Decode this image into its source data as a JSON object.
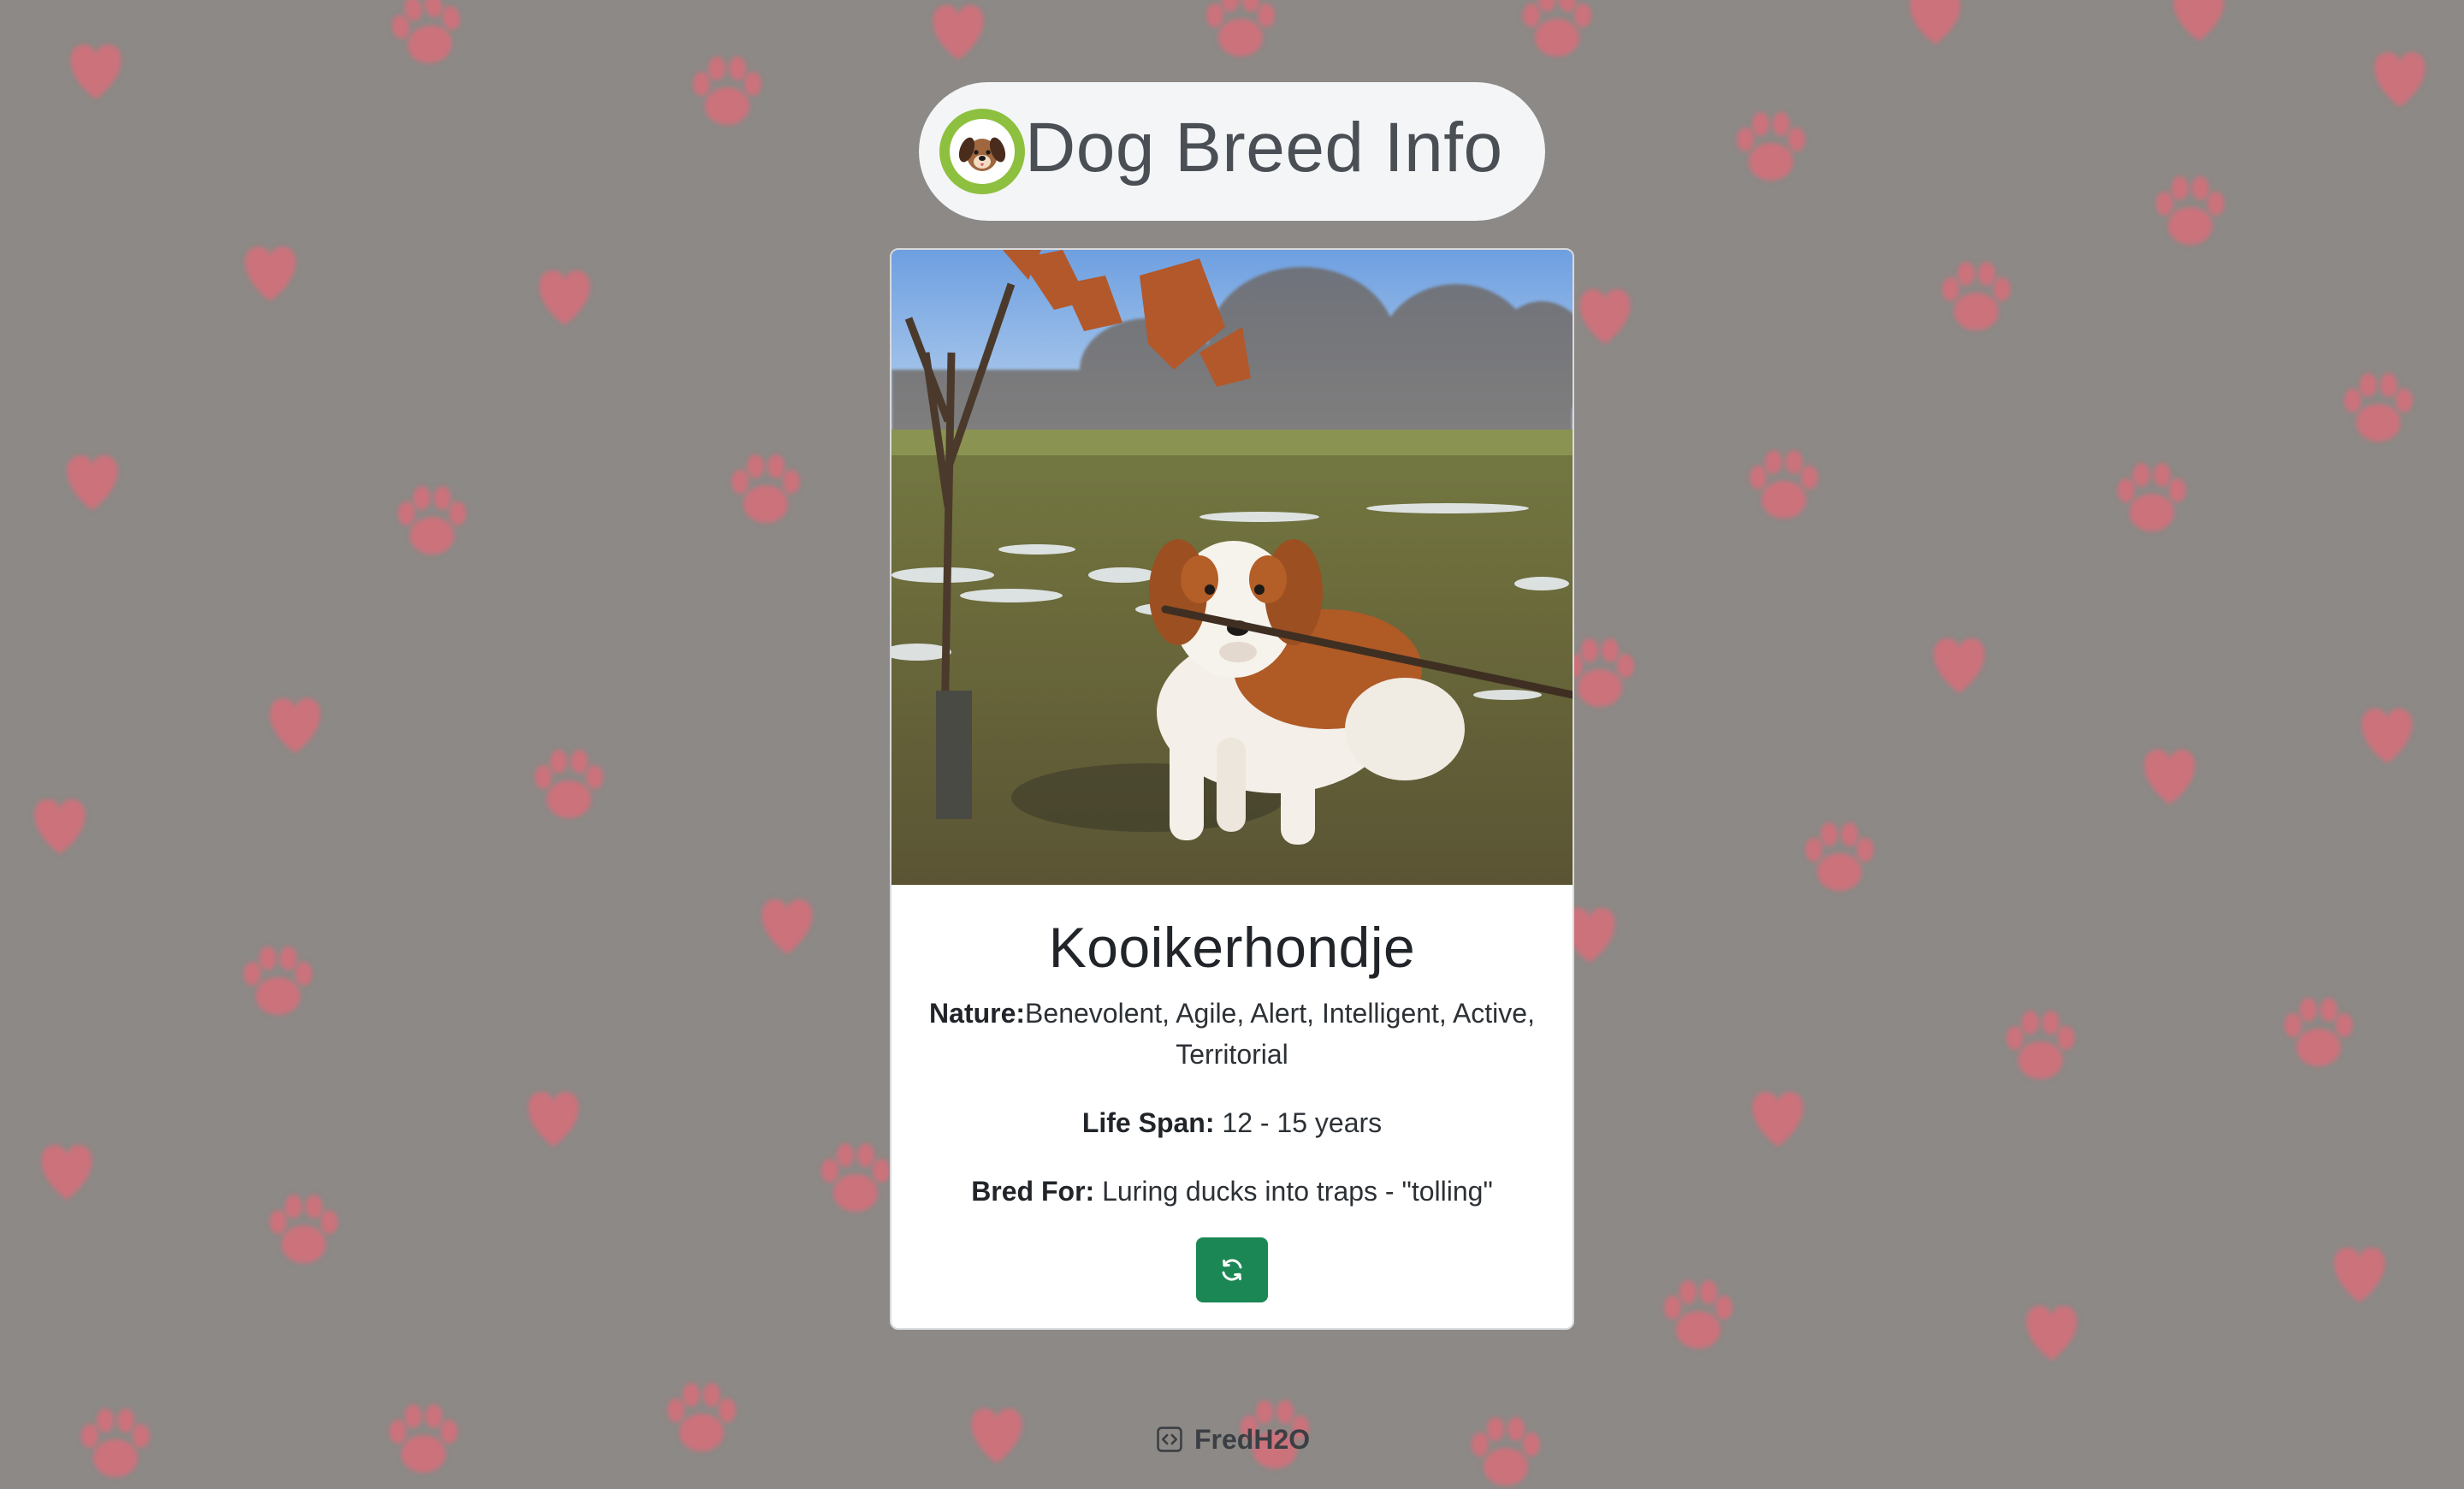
{
  "app": {
    "title": "Dog Breed Info"
  },
  "breed": {
    "name": "Kooikerhondje",
    "nature_label": "Nature:",
    "nature_value": "Benevolent, Agile, Alert, Intelligent, Active, Territorial",
    "lifespan_label": "Life Span:",
    "lifespan_value": "12 - 15 years",
    "bredfor_label": "Bred For:",
    "bredfor_value": "Luring ducks into traps - \"tolling\""
  },
  "icons": {
    "logo": "dog-face-icon",
    "refresh": "refresh-icon",
    "footer": "code-icon",
    "background": "paw-print-icon"
  },
  "footer": {
    "author": "FredH2O"
  },
  "colors": {
    "background": "#8c8986",
    "paw": "#d4707a",
    "button": "#1a8754",
    "logo_ring": "#8ec03f"
  }
}
